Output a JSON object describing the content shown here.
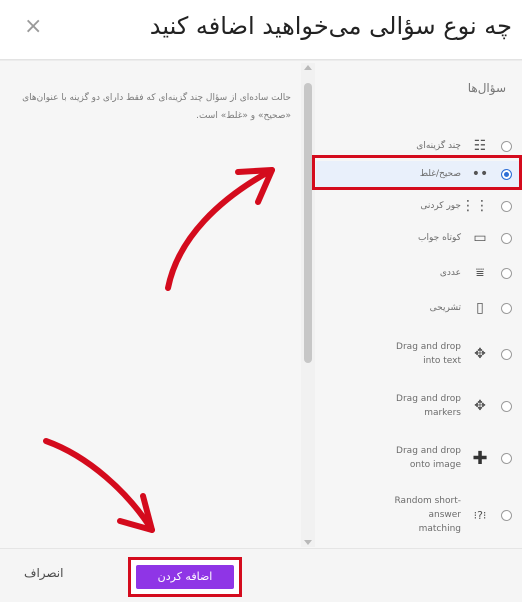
{
  "header": {
    "title": "چه نوع سؤالی می‌خواهید اضافه کنید",
    "close_icon": "×"
  },
  "description": "حالت ساده‌ای از سؤال چند گزینه‌ای که فقط دارای دو گزینه با عنوان‌های «صحیح» و «غلط» است.",
  "questions": {
    "section_title": "سؤال‌ها",
    "items": [
      {
        "label": "چند گزینه‌ای",
        "icon": "list-icon",
        "selected": false
      },
      {
        "label": "صحیح/غلط",
        "icon": "dots-icon",
        "selected": true
      },
      {
        "label": "جور کردنی",
        "icon": "grid-icon",
        "selected": false
      },
      {
        "label": "کوتاه جواب",
        "icon": "line-icon",
        "selected": false
      },
      {
        "label": "عددی",
        "icon": "numeric-icon",
        "selected": false
      },
      {
        "label": "تشریحی",
        "icon": "doc-icon",
        "selected": false
      },
      {
        "label": "Drag and drop into text",
        "icon": "move-icon",
        "selected": false
      },
      {
        "label": "Drag and drop markers",
        "icon": "move-icon",
        "selected": false
      },
      {
        "label": "Drag and drop onto image",
        "icon": "plus-icon",
        "selected": false
      },
      {
        "label": "Random short-answer matching",
        "icon": "random-icon",
        "selected": false
      }
    ]
  },
  "footer": {
    "cancel_label": "انصراف",
    "add_label": "اضافه کردن"
  },
  "colors": {
    "accent": "#8f35e6",
    "highlight": "#d40b1d",
    "selected_radio": "#2f6fd6"
  }
}
